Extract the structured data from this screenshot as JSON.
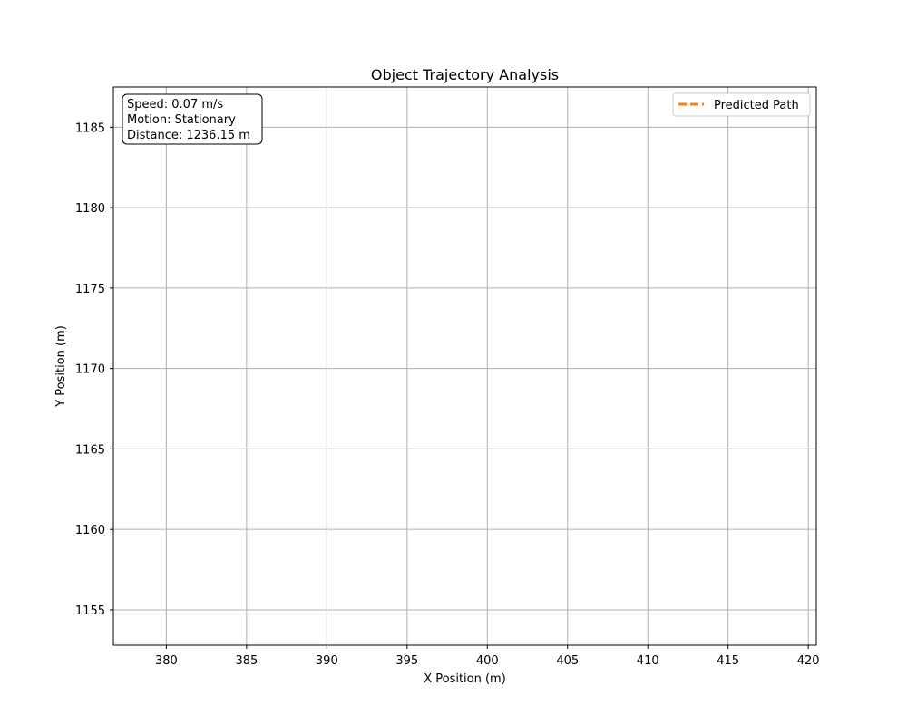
{
  "chart_data": {
    "type": "line",
    "title": "Object Trajectory Analysis",
    "xlabel": "X Position (m)",
    "ylabel": "Y Position (m)",
    "xlim": [
      376.7,
      420.5
    ],
    "ylim": [
      1152.8,
      1187.5
    ],
    "xticks": [
      380,
      385,
      390,
      395,
      400,
      405,
      410,
      415,
      420
    ],
    "yticks": [
      1155,
      1160,
      1165,
      1170,
      1175,
      1180,
      1185
    ],
    "grid": true,
    "legend_placement": "top-right",
    "series": [
      {
        "name": "Predicted Path",
        "style": "dashed",
        "color": "#ff7f0e",
        "x": [],
        "y": []
      }
    ],
    "info_box": {
      "placement": "top-left",
      "lines": [
        "Speed: 0.07 m/s",
        "Motion: Stationary",
        "Distance: 1236.15 m"
      ]
    }
  }
}
